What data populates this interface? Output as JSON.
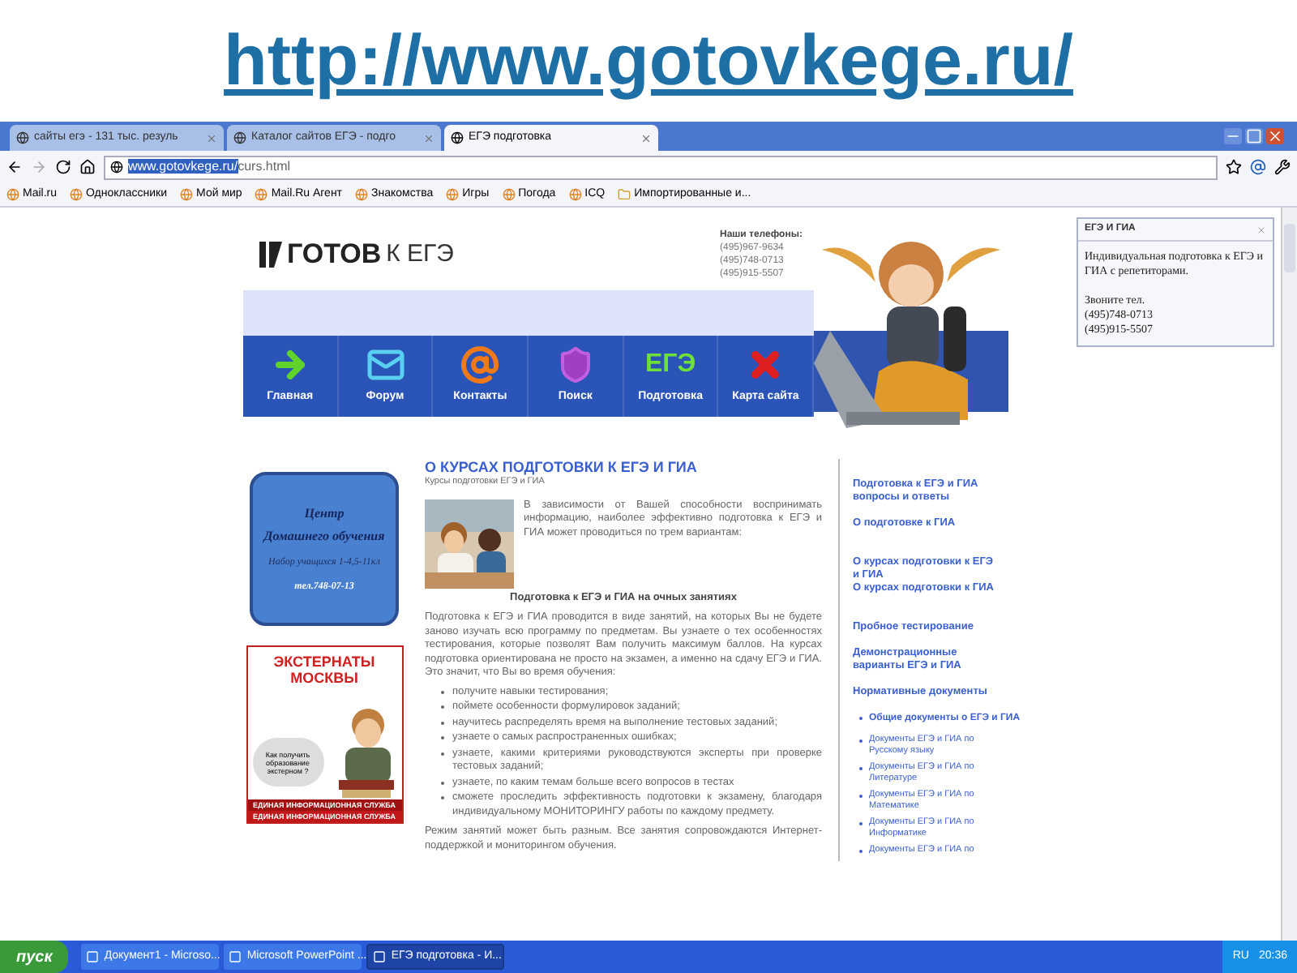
{
  "slide_title": "http://www.gotovkege.ru/",
  "browser": {
    "tabs": [
      {
        "label": "сайты егэ - 131 тыс. резуль",
        "selected": false
      },
      {
        "label": "Каталог сайтов ЕГЭ - подго",
        "selected": false
      },
      {
        "label": "ЕГЭ подготовка",
        "selected": true
      }
    ],
    "url": {
      "host": "www.gotovkege.ru/",
      "path": "curs.html"
    },
    "bookmarks": [
      "Mail.ru",
      "Одноклассники",
      "Мой мир",
      "Mail.Ru Агент",
      "Знакомства",
      "Игры",
      "Погода",
      "ICQ",
      "Импортированные и..."
    ]
  },
  "site": {
    "logo": {
      "bold": "ГОТОВ",
      "light": "К ЕГЭ"
    },
    "phones_label": "Наши телефоны:",
    "phones": [
      "(495)967-9634",
      "(495)748-0713",
      "(495)915-5507"
    ],
    "nav": [
      {
        "label": "Главная",
        "kind": "arrow"
      },
      {
        "label": "Форум",
        "kind": "envelope"
      },
      {
        "label": "Контакты",
        "kind": "at"
      },
      {
        "label": "Поиск",
        "kind": "shield"
      },
      {
        "label": "Подготовка",
        "kind": "text",
        "icon_text": "ЕГЭ"
      },
      {
        "label": "Карта сайта",
        "kind": "cross"
      }
    ],
    "banner_home": {
      "title": "Центр",
      "subtitle": "Домашнего обучения",
      "line": "Набор учащихся 1-4,5-11кл",
      "phone": "тел.748-07-13"
    },
    "banner_ext": {
      "title": "ЭКСТЕРНАТЫ МОСКВЫ",
      "bubble": "Как получить образование экстерном ?",
      "footer": [
        "ЕДИНАЯ ИНФОРМАЦИОННАЯ СЛУЖБА",
        "ЕДИНАЯ ИНФОРМАЦИОННАЯ СЛУЖБА"
      ]
    },
    "article": {
      "title": "О КУРСАХ ПОДГОТОВКИ К ЕГЭ И ГИА",
      "subtitle": "Курсы подготовки ЕГЭ и ГИА",
      "intro": "В зависимости от Вашей способности воспринимать информацию, наиболее эффективно подготовка к ЕГЭ и ГИА может проводиться по трем вариантам:",
      "heading": "Подготовка к ЕГЭ и ГИА на очных занятиях",
      "paragraph": "Подготовка к ЕГЭ и ГИА проводится в виде занятий, на которых Вы не будете заново изучать всю программу по предметам. Вы узнаете о тех особенностях тестирования, которые позволят Вам получить максимум баллов. На курсах подготовка ориентирована не просто на экзамен, а именно на сдачу ЕГЭ и ГИА. Это значит, что Вы во время обучения:",
      "bullets": [
        "получите навыки тестирования;",
        "поймете особенности формулировок заданий;",
        "научитесь распределять время на выполнение тестовых заданий;",
        "узнаете о самых распространенных ошибках;",
        "узнаете, какими критериями руководствуются эксперты при проверке тестовых заданий;",
        "узнаете, по каким темам больше всего вопросов в тестах",
        "сможете проследить эффективность подготовки к экзамену, благодаря индивидуальному МОНИТОРИНГУ работы по каждому предмету."
      ],
      "footer": "Режим занятий может быть разным. Все занятия сопровождаются Интернет-поддержкой и мониторингом обучения."
    },
    "sidebar": [
      {
        "kind": "link",
        "text": "Подготовка к ЕГЭ и ГИА вопросы и ответы"
      },
      {
        "kind": "link",
        "text": "О подготовке к ГИА"
      },
      {
        "kind": "gap"
      },
      {
        "kind": "link",
        "text": "О курсах подготовки к ЕГЭ и ГИА"
      },
      {
        "kind": "tight",
        "text": "О курсах подготовки к ГИА"
      },
      {
        "kind": "gap"
      },
      {
        "kind": "link",
        "text": "Пробное тестирование"
      },
      {
        "kind": "link",
        "text": "Демонстрационные варианты ЕГЭ и ГИА"
      },
      {
        "kind": "link",
        "text": "Нормативные документы"
      },
      {
        "kind": "bold-bullet",
        "text": "Общие документы о ЕГЭ и ГИА"
      },
      {
        "kind": "bullet",
        "text": "Документы ЕГЭ и ГИА по Русскому языку"
      },
      {
        "kind": "bullet",
        "text": "Документы ЕГЭ и ГИА по Литературе"
      },
      {
        "kind": "bullet",
        "text": "Документы ЕГЭ и ГИА по Математике"
      },
      {
        "kind": "bullet",
        "text": "Документы ЕГЭ и ГИА по Информатике"
      },
      {
        "kind": "bullet",
        "text": "Документы ЕГЭ и ГИА по"
      }
    ]
  },
  "popup": {
    "title": "ЕГЭ И ГИА",
    "text": "Индивидуальная подготовка к ЕГЭ и ГИА с репетиторами.",
    "call": "Звоните тел.",
    "phones": [
      "(495)748-0713",
      "(495)915-5507"
    ]
  },
  "taskbar": {
    "start": "пуск",
    "tasks": [
      {
        "label": "Документ1 - Microso...",
        "selected": false
      },
      {
        "label": "Microsoft PowerPoint ...",
        "selected": false
      },
      {
        "label": "ЕГЭ подготовка - И...",
        "selected": true
      }
    ],
    "lang": "RU",
    "clock": "20:36"
  }
}
